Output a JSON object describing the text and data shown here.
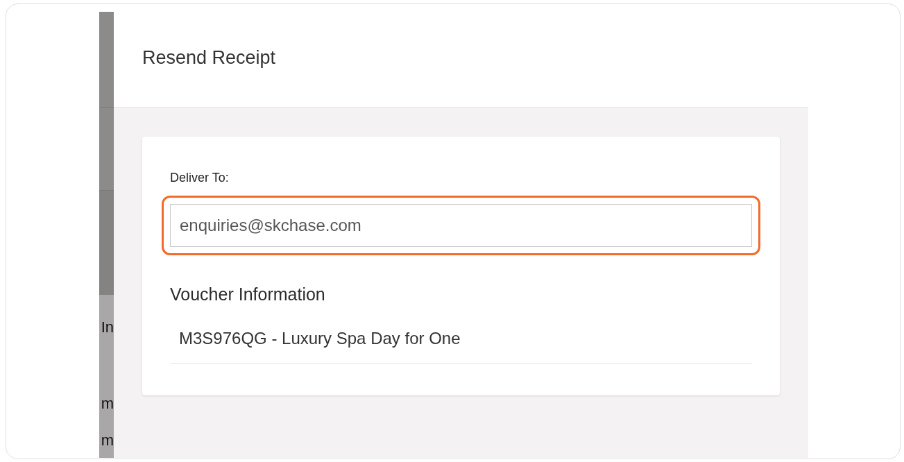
{
  "background_fragments": [
    "In",
    "m",
    "m"
  ],
  "dialog": {
    "title": "Resend Receipt",
    "deliver_to": {
      "label": "Deliver To:",
      "value": "enquiries@skchase.com",
      "highlighted": true
    },
    "voucher_section": {
      "heading": "Voucher Information",
      "items": [
        "M3S976QG - Luxury Spa Day for One"
      ]
    }
  }
}
